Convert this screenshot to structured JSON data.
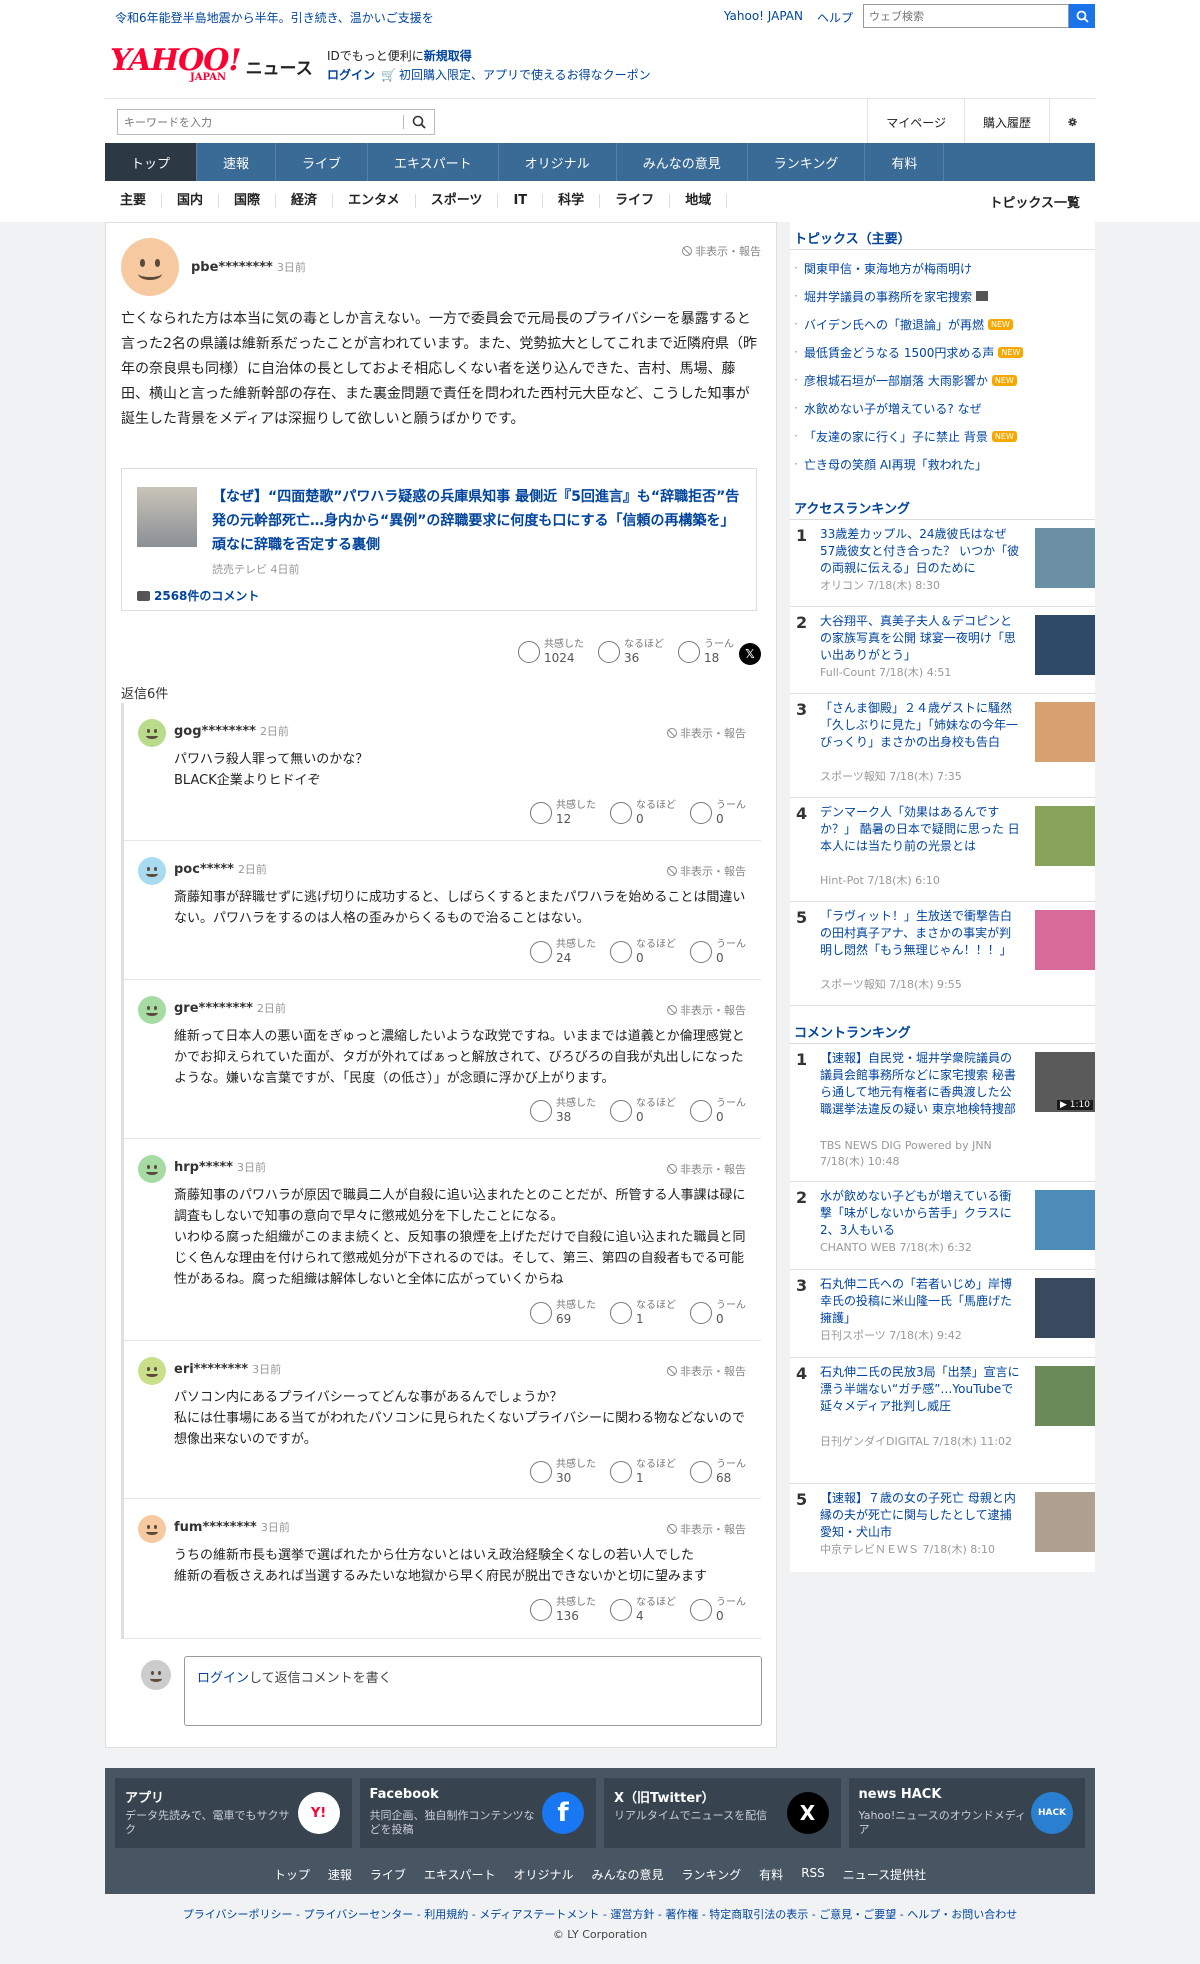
{
  "topbar": {
    "notice": "令和6年能登半島地震から半年。引き続き、温かいご支援を",
    "links": [
      "Yahoo! JAPAN",
      "ヘルプ"
    ],
    "web_search_placeholder": "ウェブ検索"
  },
  "brand": {
    "logo_text": "YAHOO!",
    "logo_sub": "JAPAN",
    "service": "ニュース",
    "promo_line1_prefix": "IDでもっと便利に",
    "promo_line1_link": "新規取得",
    "promo_login": "ログイン",
    "promo_line2": "初回購入限定、アプリで使えるお得なクーポン"
  },
  "search": {
    "placeholder": "キーワードを入力",
    "mypage": "マイページ",
    "history": "購入履歴"
  },
  "nav": [
    "トップ",
    "速報",
    "ライブ",
    "エキスパート",
    "オリジナル",
    "みんなの意見",
    "ランキング",
    "有料"
  ],
  "subnav": [
    "主要",
    "国内",
    "国際",
    "経済",
    "エンタメ",
    "スポーツ",
    "IT",
    "科学",
    "ライフ",
    "地域"
  ],
  "subnav_all": "トピックス一覧",
  "main_comment": {
    "user": "pbe********",
    "time": "3日前",
    "report": "非表示・報告",
    "body": "亡くなられた方は本当に気の毒としか言えない。一方で委員会で元局長のプライバシーを暴露すると言った2名の県議は維新系だったことが言われています。また、党勢拡大としてこれまで近隣府県（昨年の奈良県も同様）に自治体の長としておよそ相応しくない者を送り込んできた、吉村、馬場、藤田、横山と言った維新幹部の存在、また裏金問題で責任を問われた西村元大臣など、こうした知事が誕生した背景をメディアは深掘りして欲しいと願うばかりです。",
    "reactions": {
      "agree": "共感した",
      "agree_count": "1024",
      "insight": "なるほど",
      "insight_count": "36",
      "hmm": "うーん",
      "hmm_count": "18"
    }
  },
  "article": {
    "title": "【なぜ】“四面楚歌”パワハラ疑惑の兵庫県知事 最側近『5回進言』も“辞職拒否”告発の元幹部死亡…身内から“異例”の辞職要求に何度も口にする「信頼の再構築を」頑なに辞職を否定する裏側",
    "source": "読売テレビ",
    "time": "4日前",
    "comments": "2568件のコメント"
  },
  "reply_count": "返信6件",
  "replies": [
    {
      "user": "gog********",
      "time": "2日前",
      "report": "非表示・報告",
      "body": "パワハラ殺人罪って無いのかな？\nBLACK企業よりヒドイぞ",
      "agree": "12",
      "insight": "0",
      "hmm": "0",
      "color": "#b9dc8c"
    },
    {
      "user": "poc*****",
      "time": "2日前",
      "report": "非表示・報告",
      "body": "斎藤知事が辞職せずに逃げ切りに成功すると、しばらくするとまたパワハラを始めることは間違いない。パワハラをするのは人格の歪みからくるもので治ることはない。",
      "agree": "24",
      "insight": "0",
      "hmm": "0",
      "color": "#a8daf0"
    },
    {
      "user": "gre********",
      "time": "2日前",
      "report": "非表示・報告",
      "body": "維新って日本人の悪い面をぎゅっと濃縮したいような政党ですね。いままでは道義とか倫理感覚とかでお抑えられていた面が、タガが外れてばぁっと解放されて、びろびろの自我が丸出しになったような。嫌いな言葉ですが、「民度（の低さ）」が念頭に浮かび上がります。",
      "agree": "38",
      "insight": "0",
      "hmm": "0",
      "color": "#a6dba4"
    },
    {
      "user": "hrp*****",
      "time": "3日前",
      "report": "非表示・報告",
      "body": "斎藤知事のパワハラが原因で職員二人が自殺に追い込まれたとのことだが、所管する人事課は碌に調査もしないで知事の意向で早々に懲戒処分を下したことになる。\nいわゆる腐った組織がこのまま続くと、反知事の狼煙を上げただけで自殺に追い込まれた職員と同じく色んな理由を付けられて懲戒処分が下されるのでは。そして、第三、第四の自殺者もでる可能性があるね。腐った組織は解体しないと全体に広がっていくからね",
      "agree": "69",
      "insight": "1",
      "hmm": "0",
      "color": "#a6dba4"
    },
    {
      "user": "eri********",
      "time": "3日前",
      "report": "非表示・報告",
      "body": "パソコン内にあるプライバシーってどんな事があるんでしょうか？\n私には仕事場にある当てがわれたパソコンに見られたくないプライバシーに関わる物などないので想像出来ないのですが。",
      "agree": "30",
      "insight": "1",
      "hmm": "68",
      "color": "#c9df8a"
    },
    {
      "user": "fum********",
      "time": "3日前",
      "report": "非表示・報告",
      "body": "うちの維新市長も選挙で選ばれたから仕方ないとはいえ政治経験全くなしの若い人でした\n維新の看板さえあれば当選するみたいな地獄から早く府民が脱出できないかと切に望みます",
      "agree": "136",
      "insight": "4",
      "hmm": "0",
      "color": "#f6c9a0"
    }
  ],
  "reaction_labels": {
    "agree": "共感した",
    "insight": "なるほど",
    "hmm": "うーん"
  },
  "reply_input": {
    "login": "ログイン",
    "text": "して返信コメントを書く"
  },
  "sidebar": {
    "topics_title": "トピックス（主要）",
    "topics": [
      {
        "text": "関東甲信・東海地方が梅雨明け",
        "badge": ""
      },
      {
        "text": "堀井学議員の事務所を家宅捜索",
        "badge": "video"
      },
      {
        "text": "バイデン氏への「撤退論」が再燃",
        "badge": "NEW"
      },
      {
        "text": "最低賃金どうなる 1500円求める声",
        "badge": "NEW"
      },
      {
        "text": "彦根城石垣が一部崩落 大雨影響か",
        "badge": "NEW"
      },
      {
        "text": "水飲めない子が増えている? なぜ",
        "badge": ""
      },
      {
        "text": "「友達の家に行く」子に禁止 背景",
        "badge": "NEW"
      },
      {
        "text": "亡き母の笑顔 AI再現「救われた」",
        "badge": ""
      }
    ],
    "access_title": "アクセスランキング",
    "access": [
      {
        "num": "1",
        "title": "33歳差カップル、24歳彼氏はなぜ57歳彼女と付き合った？ いつか「彼の両親に伝える」日のために",
        "source": "オリコン 7/18(木) 8:30",
        "color": "#6b8fa3"
      },
      {
        "num": "2",
        "title": "大谷翔平、真美子夫人＆デコピンとの家族写真を公開 球宴一夜明け「思い出ありがとう」",
        "source": "Full-Count 7/18(木) 4:51",
        "color": "#2f4a66"
      },
      {
        "num": "3",
        "title": "「さんま御殿」２４歳ゲストに騒然「久しぶりに見た」「姉妹なの今年一びっくり」まさかの出身校も告白",
        "source": "スポーツ報知 7/18(木) 7:35",
        "color": "#d6a070"
      },
      {
        "num": "4",
        "title": "デンマーク人「効果はあるんですか？」 酷暑の日本で疑問に思った 日本人には当たり前の光景とは",
        "source": "Hint-Pot 7/18(木) 6:10",
        "color": "#8aa35a"
      },
      {
        "num": "5",
        "title": "「ラヴィット！」生放送で衝撃告白の田村真子アナ、まさかの事実が判明し悶然「もう無理じゃん！！！」",
        "source": "スポーツ報知 7/18(木) 9:55",
        "color": "#d86a9a"
      }
    ],
    "comment_title": "コメントランキング",
    "comment_rank": [
      {
        "num": "1",
        "title": "【速報】自民党・堀井学衆院議員の議員会館事務所などに家宅捜索 秘書ら通して地元有権者に香典渡した公職選挙法違反の疑い 東京地検特捜部",
        "source": "TBS NEWS DIG Powered by JNN 7/18(木) 10:48",
        "color": "#5a5a5a",
        "video": "▶ 1:10"
      },
      {
        "num": "2",
        "title": "水が飲めない子どもが増えている衝撃「味がしないから苦手」クラスに2、3人もいる",
        "source": "CHANTO WEB 7/18(木) 6:32",
        "color": "#4d8bb8",
        "video": ""
      },
      {
        "num": "3",
        "title": "石丸伸二氏への「若者いじめ」岸博幸氏の投稿に米山隆一氏「馬鹿げた擁護」",
        "source": "日刊スポーツ 7/18(木) 9:42",
        "color": "#3a4a5e",
        "video": ""
      },
      {
        "num": "4",
        "title": "石丸伸二氏の民放3局「出禁」宣言に漂う半端ない“ガチ感”…YouTubeで延々メディア批判し威圧",
        "source": "日刊ゲンダイDIGITAL 7/18(木) 11:02",
        "color": "#6a8a5a",
        "video": ""
      },
      {
        "num": "5",
        "title": "【速報】７歳の女の子死亡 母親と内縁の夫が死亡に関与したとして逮捕 愛知・犬山市",
        "source": "中京テレビＮＥＷＳ 7/18(木) 8:10",
        "color": "#b0a090",
        "video": ""
      }
    ]
  },
  "footer": {
    "cards": [
      {
        "title": "アプリ",
        "desc": "データ先読みで、電車でもサクサク",
        "icon": "yahoo-app-icon",
        "bg": "#ffffff",
        "fg": "#ff0033",
        "glyph": "Y!"
      },
      {
        "title": "Facebook",
        "desc": "共同企画、独自制作コンテンツなどを投稿",
        "icon": "facebook-icon",
        "bg": "#1877f2",
        "fg": "#ffffff",
        "glyph": "f"
      },
      {
        "title": "X（旧Twitter）",
        "desc": "リアルタイムでニュースを配信",
        "icon": "x-icon",
        "bg": "#000000",
        "fg": "#ffffff",
        "glyph": "X"
      },
      {
        "title": "news HACK",
        "desc": "Yahoo!ニュースのオウンドメディア",
        "icon": "news-hack-icon",
        "bg": "#2a7fd0",
        "fg": "#ffffff",
        "glyph": "HACK"
      }
    ],
    "nav": [
      "トップ",
      "速報",
      "ライブ",
      "エキスパート",
      "オリジナル",
      "みんなの意見",
      "ランキング",
      "有料",
      "RSS",
      "ニュース提供社"
    ],
    "legal": "プライバシーポリシー - プライバシーセンター - 利用規約 - メディアステートメント - 運営方針 - 著作権 - 特定商取引法の表示 - ご意見・ご要望 - ヘルプ・お問い合わせ",
    "copyright": "© LY Corporation"
  }
}
